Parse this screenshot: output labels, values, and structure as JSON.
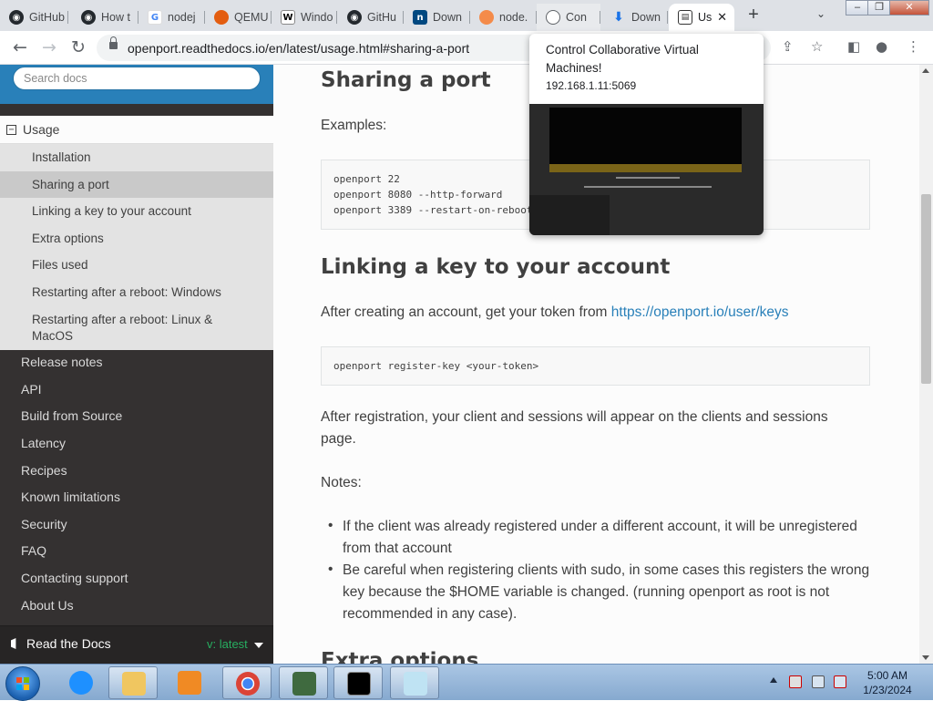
{
  "browser": {
    "tabs": [
      {
        "label": "GitHub",
        "icon": "github-icon"
      },
      {
        "label": "How t",
        "icon": "github-icon"
      },
      {
        "label": "nodej",
        "icon": "google-icon"
      },
      {
        "label": "QEMU",
        "icon": "qemu-icon"
      },
      {
        "label": "Windo",
        "icon": "wikipedia-icon"
      },
      {
        "label": "GitHu",
        "icon": "github-icon"
      },
      {
        "label": "Down",
        "icon": "nuget-icon"
      },
      {
        "label": "node.",
        "icon": "orange-icon"
      },
      {
        "label": "Con",
        "icon": "globe-icon"
      },
      {
        "label": "Down",
        "icon": "download-icon"
      },
      {
        "label": "Us",
        "icon": "docs-icon"
      }
    ],
    "new_tab_label": "+",
    "tab_search_label": "⌄",
    "window_controls": {
      "minimize": "–",
      "maximize": "❐",
      "close": "✕"
    },
    "url": "openport.readthedocs.io/en/latest/usage.html#sharing-a-port"
  },
  "hover_card": {
    "title": "Control Collaborative Virtual Machines!",
    "url": "192.168.1.11:5069"
  },
  "sidebar": {
    "search_placeholder": "Search docs",
    "current_section": "Usage",
    "subitems": [
      "Installation",
      "Sharing a port",
      "Linking a key to your account",
      "Extra options",
      "Files used",
      "Restarting after a reboot: Windows",
      "Restarting after a reboot: Linux & MacOS"
    ],
    "current_subitem": "Sharing a port",
    "items": [
      "Release notes",
      "API",
      "Build from Source",
      "Latency",
      "Recipes",
      "Known limitations",
      "Security",
      "FAQ",
      "Contacting support",
      "About Us"
    ],
    "footer": {
      "label": "Read the Docs",
      "version": "v: latest"
    }
  },
  "content": {
    "h_sharing": "Sharing a port",
    "examples_label": "Examples:",
    "examples_code": [
      "openport 22",
      "openport 8080 --http-forward",
      "openport 3389 --restart-on-reboot"
    ],
    "h_linking": "Linking a key to your account",
    "after_creating_text": "After creating an account, get your token from ",
    "token_link": "https://openport.io/user/keys",
    "register_code": "openport register-key <your-token>",
    "after_registration": "After registration, your client and sessions will appear on the clients and sessions page.",
    "notes_label": "Notes:",
    "notes": [
      "If the client was already registered under a different account, it will be unregistered from that account",
      "Be careful when registering clients with sudo, in some cases this registers the wrong key because the $HOME variable is changed. (running openport as root is not recommended in any case)."
    ],
    "h_extra": "Extra options"
  },
  "taskbar": {
    "apps": [
      "internet-explorer",
      "file-explorer",
      "media-player",
      "chrome",
      "network-monitor",
      "command-prompt",
      "notepad"
    ],
    "time": "5:00 AM",
    "date": "1/23/2024"
  },
  "colors": {
    "sidebar_bg": "#343131",
    "search_bg": "#2980b9",
    "link": "#2980b9",
    "version_green": "#27ae60"
  }
}
